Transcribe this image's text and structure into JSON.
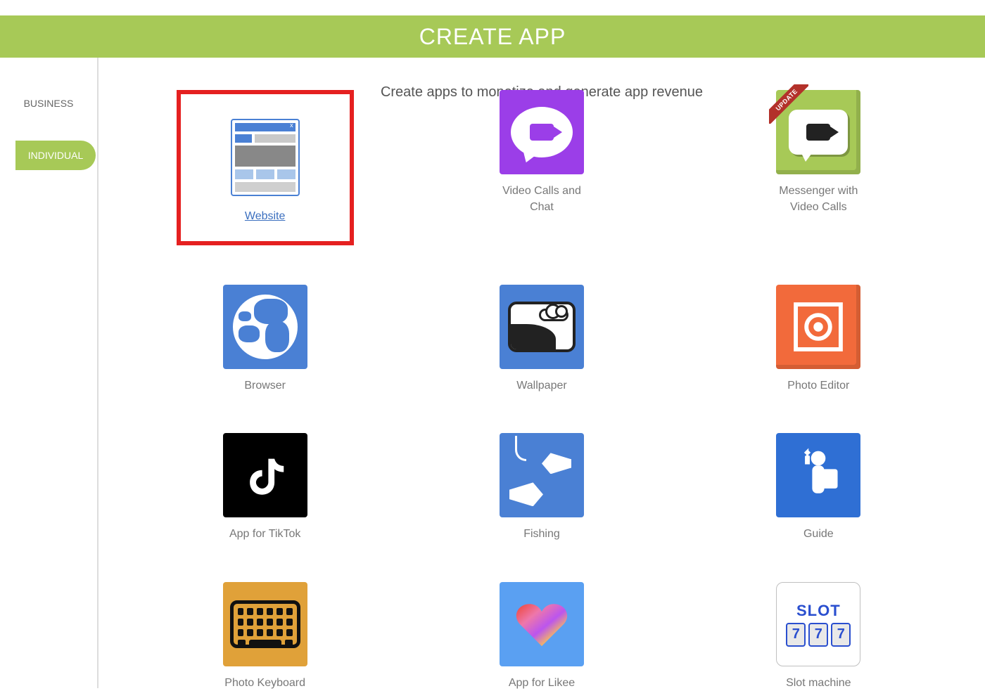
{
  "header": {
    "title": "CREATE APP"
  },
  "sidebar": {
    "items": [
      {
        "label": "BUSINESS"
      },
      {
        "label": "INDIVIDUAL"
      }
    ]
  },
  "subtitle": "Create apps to monetize and generate app revenue",
  "badges": {
    "update": "UPDATE"
  },
  "apps": [
    {
      "label": "Website"
    },
    {
      "label": "Video Calls and\nChat"
    },
    {
      "label": "Messenger with\nVideo Calls"
    },
    {
      "label": "Browser"
    },
    {
      "label": "Wallpaper"
    },
    {
      "label": "Photo Editor"
    },
    {
      "label": "App for TikTok"
    },
    {
      "label": "Fishing"
    },
    {
      "label": "Guide"
    },
    {
      "label": "Photo Keyboard"
    },
    {
      "label": "App for Likee"
    },
    {
      "label": "Slot machine"
    }
  ],
  "slot": {
    "title": "SLOT",
    "digits": [
      "7",
      "7",
      "7"
    ]
  }
}
